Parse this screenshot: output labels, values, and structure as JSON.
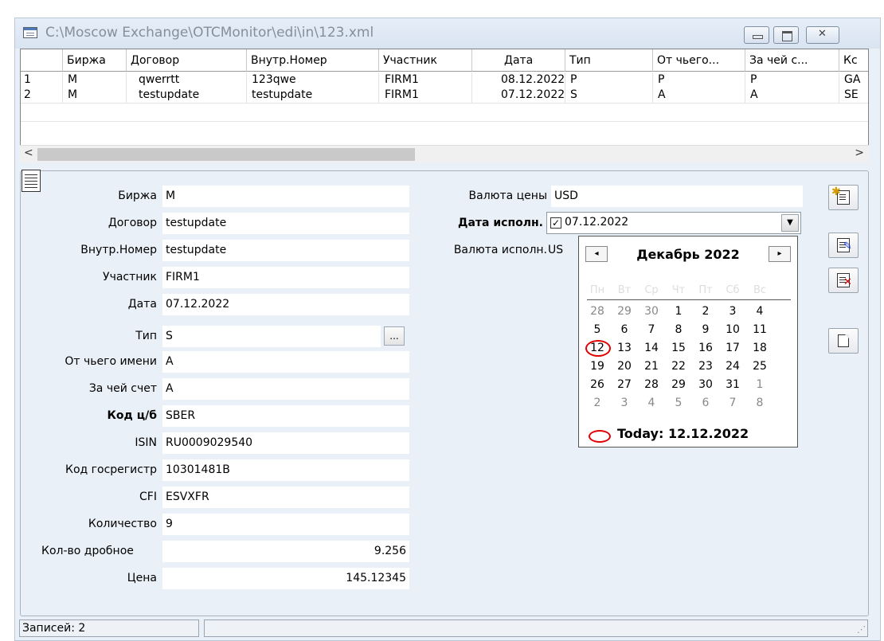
{
  "window": {
    "title": "C:\\Moscow Exchange\\OTCMonitor\\edi\\in\\123.xml",
    "icon": "window-app-icon"
  },
  "grid": {
    "columns": [
      "",
      "Биржа",
      "Договор",
      "Внутр.Номер",
      "Участник",
      "Дата",
      "Тип",
      "От чьего...",
      "За чей с...",
      "Кс"
    ],
    "rows": [
      [
        "1",
        "M",
        "qwerrtt",
        "123qwe",
        "FIRM1",
        "08.12.2022",
        "P",
        "P",
        "P",
        "GA"
      ],
      [
        "2",
        "M",
        "testupdate",
        "testupdate",
        "FIRM1",
        "07.12.2022",
        "S",
        "A",
        "A",
        "SE"
      ]
    ]
  },
  "form": {
    "birzha_label": "Биржа",
    "birzha_value": "M",
    "dogovor_label": "Договор",
    "dogovor_value": "testupdate",
    "vnutr_label": "Внутр.Номер",
    "vnutr_value": "testupdate",
    "uchastnik_label": "Участник",
    "uchastnik_value": "FIRM1",
    "data_label": "Дата",
    "data_value": "07.12.2022",
    "tip_label": "Тип",
    "tip_value": "S",
    "ellipsis_label": "...",
    "ot_label": "От чьего имени",
    "ot_value": "A",
    "za_label": "За чей счет",
    "za_value": "A",
    "kod_label": "Код ц/б",
    "kod_value": "SBER",
    "isin_label": "ISIN",
    "isin_value": "RU0009029540",
    "gosreg_label": "Код госрегистр",
    "gosreg_value": "10301481B",
    "cfi_label": "CFI",
    "cfi_value": "ESVXFR",
    "kolvo_label": "Количество",
    "kolvo_value": "9",
    "drob_label": "Кол-во дробное",
    "drob_value": "9.256",
    "cena_label": "Цена",
    "cena_value": "145.12345",
    "valuta_ceny_label": "Валюта цены",
    "valuta_ceny_value": "USD",
    "data_isp_label": "Дата исполн.",
    "data_isp_value": "07.12.2022",
    "data_isp_checked": "✓",
    "valuta_isp_label": "Валюта исполн.",
    "valuta_isp_value": "US"
  },
  "calendar": {
    "title": "Декабрь 2022",
    "weekdays": [
      "Пн",
      "Вт",
      "Ср",
      "Чт",
      "Пт",
      "Сб",
      "Вс"
    ],
    "weeks": [
      [
        "28",
        "29",
        "30",
        "1",
        "2",
        "3",
        "4"
      ],
      [
        "5",
        "6",
        "7",
        "8",
        "9",
        "10",
        "11"
      ],
      [
        "12",
        "13",
        "14",
        "15",
        "16",
        "17",
        "18"
      ],
      [
        "19",
        "20",
        "21",
        "22",
        "23",
        "24",
        "25"
      ],
      [
        "26",
        "27",
        "28",
        "29",
        "30",
        "31",
        "1"
      ],
      [
        "2",
        "3",
        "4",
        "5",
        "6",
        "7",
        "8"
      ]
    ],
    "today_text": "Today: 12.12.2022",
    "accent_color": "#e00000"
  },
  "status": {
    "records": "Записей: 2"
  }
}
